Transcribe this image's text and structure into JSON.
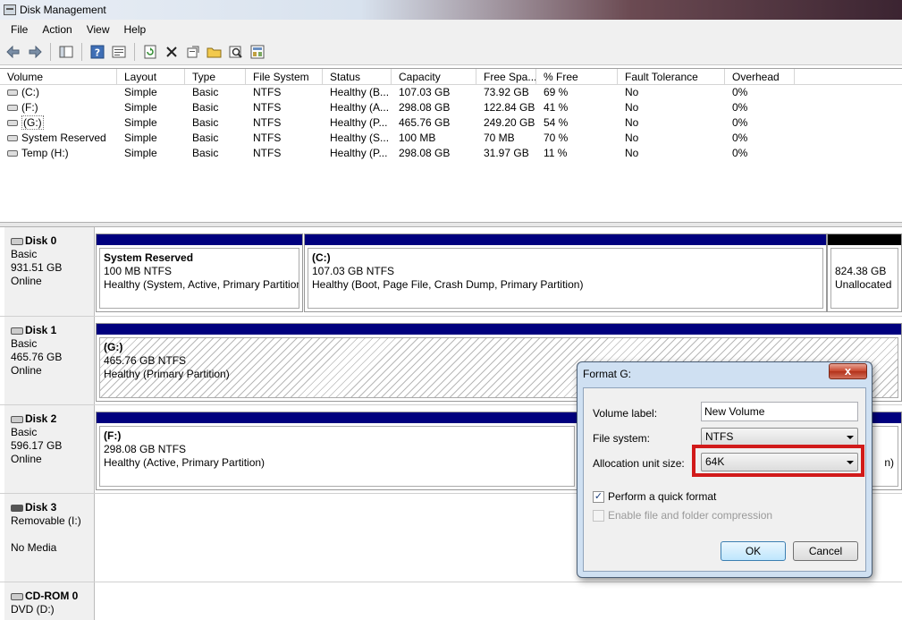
{
  "window": {
    "title": "Disk Management"
  },
  "menu": [
    "File",
    "Action",
    "View",
    "Help"
  ],
  "toolbar": {
    "icons": [
      "back-arrow-icon",
      "forward-arrow-icon",
      "show-hide-tree-icon",
      "help-icon",
      "properties-icon",
      "refresh-icon",
      "delete-icon",
      "rescan-icon",
      "open-folder-icon",
      "search-icon",
      "export-icon"
    ]
  },
  "volume_table": {
    "headers": [
      "Volume",
      "Layout",
      "Type",
      "File System",
      "Status",
      "Capacity",
      "Free Spa...",
      "% Free",
      "Fault Tolerance",
      "Overhead"
    ],
    "rows": [
      [
        "(C:)",
        "Simple",
        "Basic",
        "NTFS",
        "Healthy (B...",
        "107.03 GB",
        "73.92 GB",
        "69 %",
        "No",
        "0%"
      ],
      [
        "(F:)",
        "Simple",
        "Basic",
        "NTFS",
        "Healthy (A...",
        "298.08 GB",
        "122.84 GB",
        "41 %",
        "No",
        "0%"
      ],
      [
        "(G:)",
        "Simple",
        "Basic",
        "NTFS",
        "Healthy (P...",
        "465.76 GB",
        "249.20 GB",
        "54 %",
        "No",
        "0%"
      ],
      [
        "System Reserved",
        "Simple",
        "Basic",
        "NTFS",
        "Healthy (S...",
        "100 MB",
        "70 MB",
        "70 %",
        "No",
        "0%"
      ],
      [
        "Temp (H:)",
        "Simple",
        "Basic",
        "NTFS",
        "Healthy (P...",
        "298.08 GB",
        "31.97 GB",
        "11 %",
        "No",
        "0%"
      ]
    ]
  },
  "disks": {
    "disk0": {
      "name": "Disk 0",
      "type": "Basic",
      "size": "931.51 GB",
      "state": "Online",
      "partitions": [
        {
          "name": "System Reserved",
          "size": "100 MB NTFS",
          "status": "Healthy (System, Active, Primary Partition)"
        },
        {
          "name": "(C:)",
          "size": "107.03 GB NTFS",
          "status": "Healthy (Boot, Page File, Crash Dump, Primary Partition)"
        },
        {
          "name": "",
          "size": "824.38 GB",
          "status": "Unallocated"
        }
      ]
    },
    "disk1": {
      "name": "Disk 1",
      "type": "Basic",
      "size": "465.76 GB",
      "state": "Online",
      "partitions": [
        {
          "name": "(G:)",
          "size": "465.76 GB NTFS",
          "status": "Healthy (Primary Partition)"
        }
      ]
    },
    "disk2": {
      "name": "Disk 2",
      "type": "Basic",
      "size": "596.17 GB",
      "state": "Online",
      "partitions": [
        {
          "name": "(F:)",
          "size": "298.08 GB NTFS",
          "status": "Healthy (Active, Primary Partition)"
        },
        {
          "name": "",
          "size": "",
          "status": "n)"
        }
      ]
    },
    "disk3": {
      "name": "Disk 3",
      "type": "Removable (I:)",
      "state": "No Media"
    },
    "cdrom0": {
      "name": "CD-ROM 0",
      "type": "DVD (D:)"
    }
  },
  "format_dialog": {
    "title": "Format G:",
    "close_label": "x",
    "volume_label_caption": "Volume label:",
    "volume_label_value": "New Volume",
    "file_system_caption": "File system:",
    "file_system_value": "NTFS",
    "allocation_caption": "Allocation unit size:",
    "allocation_value": "64K",
    "quick_format_label": "Perform a quick format",
    "quick_format_checked": true,
    "compression_label": "Enable file and folder compression",
    "compression_checked": false,
    "ok_label": "OK",
    "cancel_label": "Cancel",
    "highlight_color": "#d11a1a"
  }
}
